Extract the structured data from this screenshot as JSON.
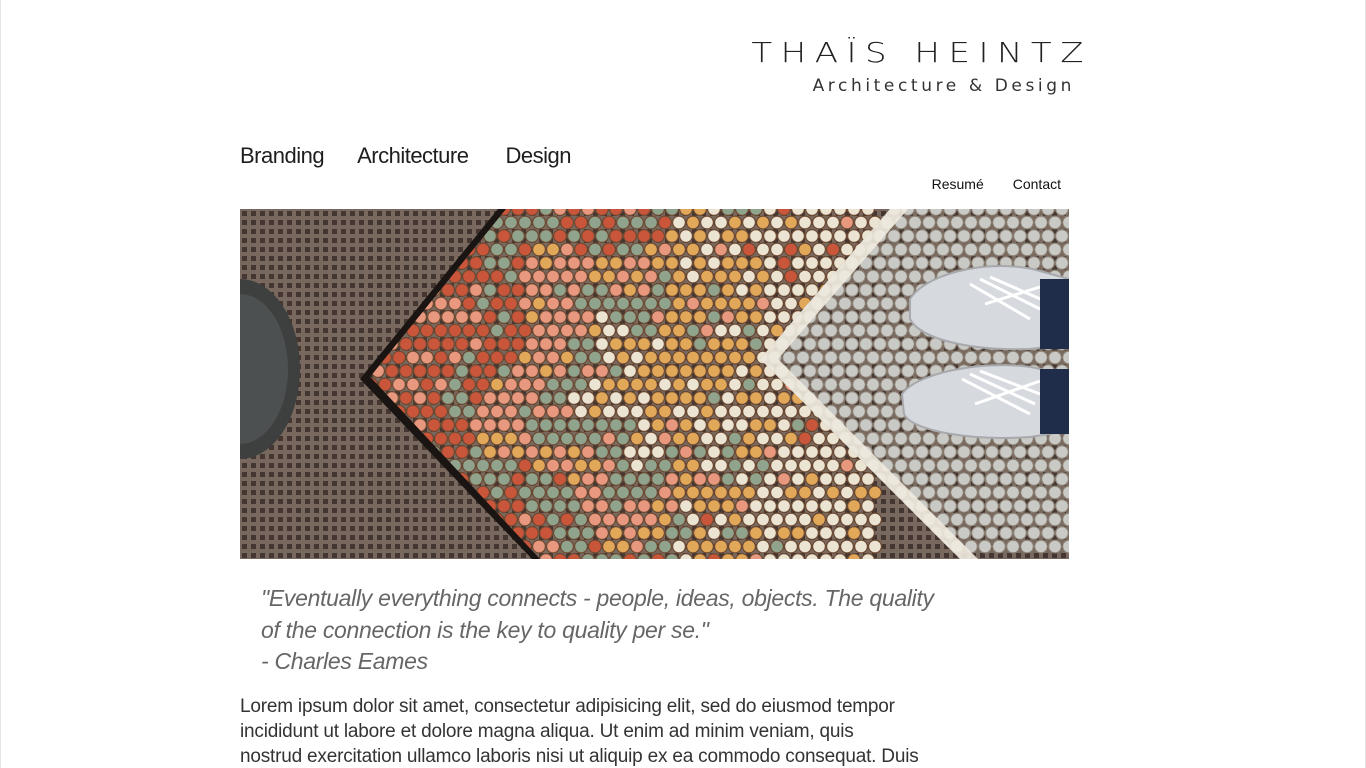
{
  "header": {
    "brand_name": "THAÏS HEINTZ",
    "brand_tagline": "Architecture & Design"
  },
  "main_nav": {
    "items": [
      {
        "label": "Branding"
      },
      {
        "label": "Architecture"
      },
      {
        "label": "Design"
      }
    ]
  },
  "sub_nav": {
    "items": [
      {
        "label": "Resumé"
      },
      {
        "label": "Contact"
      }
    ]
  },
  "hero": {
    "icon": "mosaic-tile-floor-photo",
    "colors": {
      "grate": "#5a4a40",
      "red": "#c9553a",
      "sage": "#8fa38d",
      "peach": "#e8987e",
      "gold": "#e2a85a",
      "cream": "#ece4d2",
      "grey_tile": "#c9c9c6",
      "shoe": "#d9dbe0",
      "jeans": "#1f2c4a"
    }
  },
  "quote": {
    "line1": "\"Eventually everything connects - people, ideas, objects. The quality",
    "line2": "of the connection is the key to quality per se.\"",
    "attribution": "- Charles Eames"
  },
  "body": {
    "line1": "Lorem ipsum dolor sit amet, consectetur adipisicing elit, sed do eiusmod tempor",
    "line2": "incididunt ut labore et dolore magna aliqua. Ut enim ad minim veniam, quis",
    "line3": "nostrud exercitation ullamco laboris nisi ut aliquip ex ea commodo consequat. Duis"
  }
}
